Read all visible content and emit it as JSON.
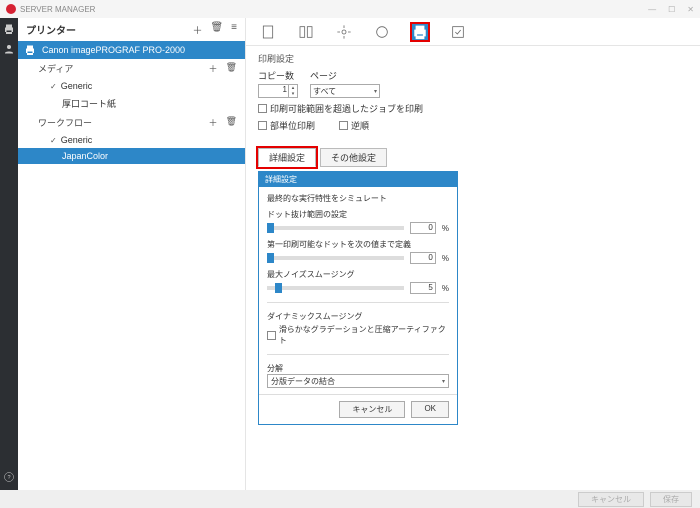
{
  "titlebar": {
    "app": "SERVER MANAGER"
  },
  "sidebar": {
    "header": "プリンター",
    "printer": "Canon imagePROGRAF PRO-2000",
    "groups": {
      "media": {
        "label": "メディア",
        "items": [
          "Generic",
          "厚口コート紙"
        ]
      },
      "workflow": {
        "label": "ワークフロー",
        "items": [
          "Generic",
          "JapanColor"
        ]
      }
    }
  },
  "print": {
    "section": "印刷設定",
    "copies_lbl": "コピー数",
    "copies_val": "1",
    "pages_lbl": "ページ",
    "pages_val": "すべて",
    "cb1": "印刷可能範囲を超過したジョブを印刷",
    "cb2": "部単位印刷",
    "cb3": "逆順",
    "tabs": {
      "detail": "詳細設定",
      "other": "その他設定"
    }
  },
  "panel": {
    "header": "詳細設定",
    "sub": "最終的な実行特性をシミュレート",
    "s1_lbl": "ドット抜け範囲の設定",
    "s1_val": "0",
    "unit": "%",
    "s2_lbl": "第一印刷可能なドットを次の値まで定義",
    "s2_val": "0",
    "s3_lbl": "最大ノイズスムージング",
    "s3_val": "5",
    "dyn": "ダイナミックスムージング",
    "dyn_cb": "滑らかなグラデーションと圧縮アーティファクト",
    "res_lbl": "分解",
    "res_val": "分版データの結合",
    "cancel": "キャンセル",
    "ok": "OK"
  },
  "footer": {
    "cancel": "キャンセル",
    "save": "保存"
  }
}
